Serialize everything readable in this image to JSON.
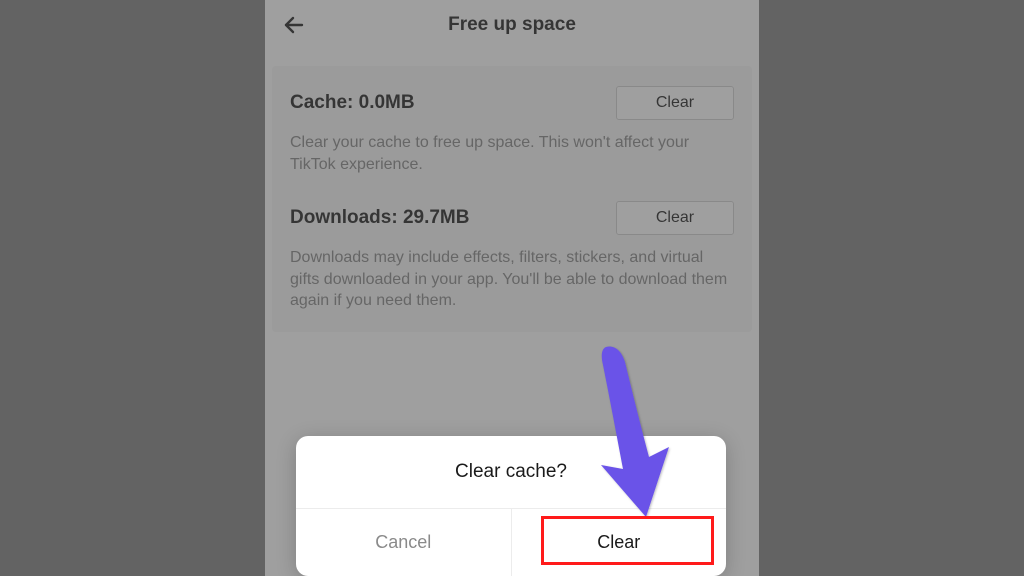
{
  "header": {
    "title": "Free up space"
  },
  "cache": {
    "title": "Cache: 0.0MB",
    "button": "Clear",
    "desc": "Clear your cache to free up space. This won't affect your TikTok experience."
  },
  "downloads": {
    "title": "Downloads: 29.7MB",
    "button": "Clear",
    "desc": "Downloads may include effects, filters, stickers, and virtual gifts downloaded in your app. You'll be able to download them again if you need them."
  },
  "dialog": {
    "title": "Clear cache?",
    "cancel": "Cancel",
    "confirm": "Clear"
  }
}
